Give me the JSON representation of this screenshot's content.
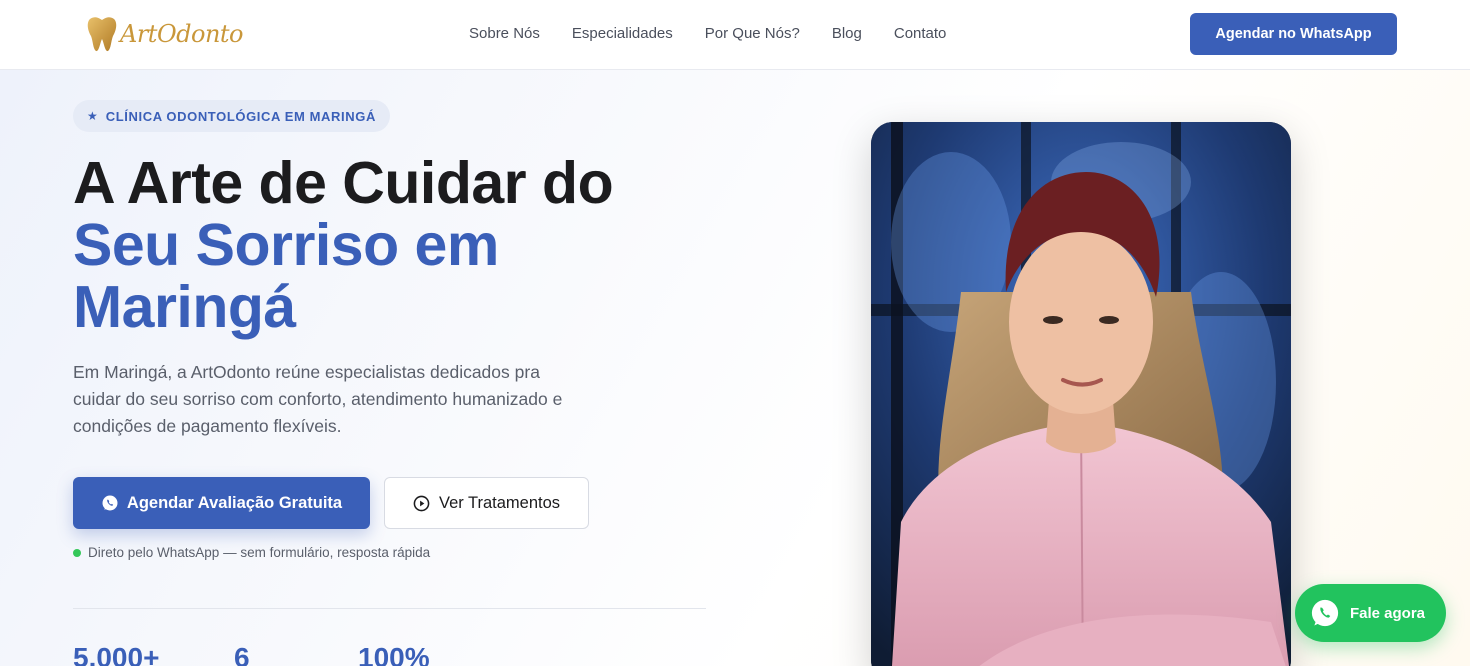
{
  "header": {
    "logo_text": "ArtOdonto",
    "logo_icon": "tooth-logo-icon",
    "nav": [
      {
        "label": "Sobre Nós"
      },
      {
        "label": "Especialidades"
      },
      {
        "label": "Por Que Nós?"
      },
      {
        "label": "Blog"
      },
      {
        "label": "Contato"
      }
    ],
    "cta_label": "Agendar no WhatsApp"
  },
  "hero": {
    "badge": "CLÍNICA ODONTOLÓGICA EM MARINGÁ",
    "badge_icon": "star-icon",
    "headline_line1": "A Arte de Cuidar do",
    "headline_line2": "Seu Sorriso em",
    "headline_line3": "Maringá",
    "lead": "Em Maringá, a ArtOdonto reúne especialistas dedicados pra cuidar do seu sorriso com conforto, atendimento humanizado e condições de pagamento flexíveis.",
    "primary_button": "Agendar Avaliação Gratuita",
    "primary_icon": "whatsapp-icon",
    "secondary_button": "Ver Tratamentos",
    "secondary_icon": "play-circle-icon",
    "note": "Direto pelo WhatsApp — sem formulário, resposta rápida",
    "stats": [
      "5.000+",
      "6",
      "100%"
    ]
  },
  "floating": {
    "label": "Fale agora",
    "icon": "whatsapp-icon"
  },
  "colors": {
    "brand_blue": "#3a5fb8",
    "gold": "#c9973a",
    "whatsapp_green": "#22c35e",
    "text_dark": "#1c1c1e"
  }
}
